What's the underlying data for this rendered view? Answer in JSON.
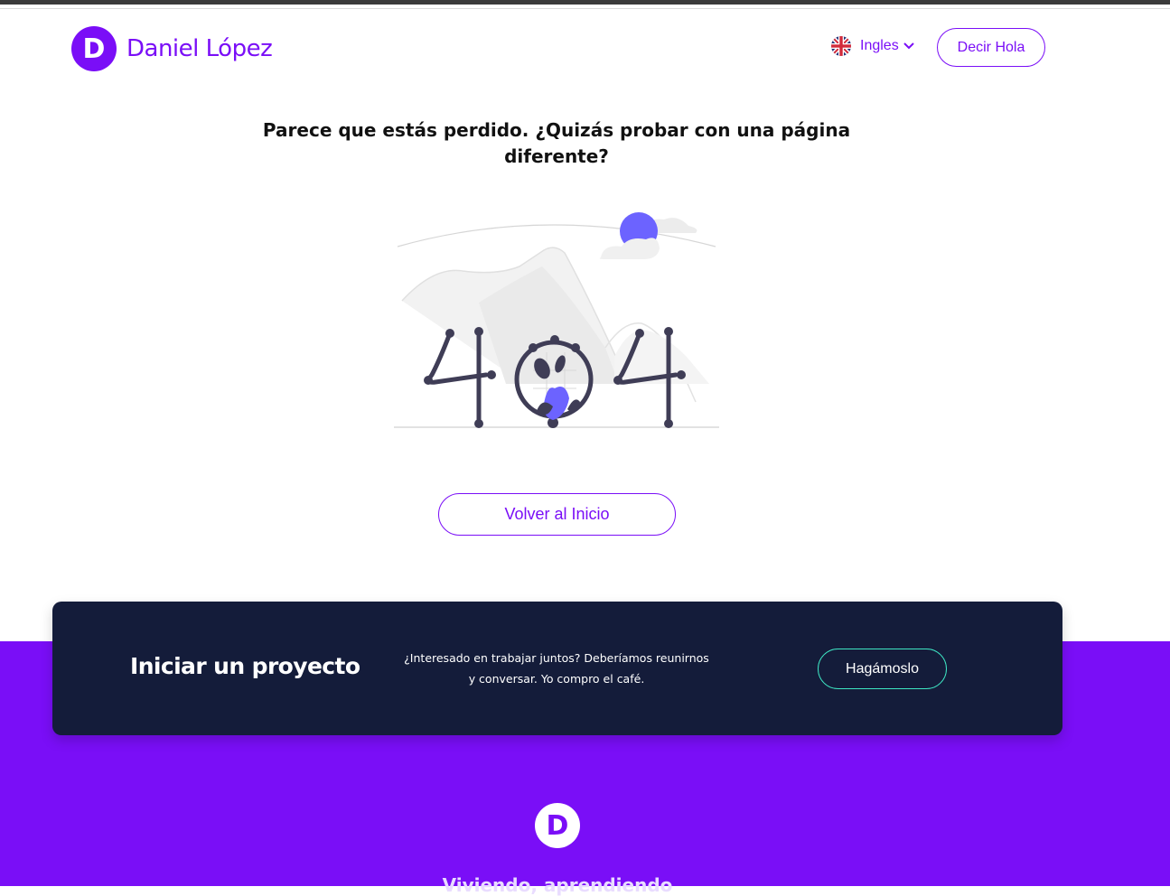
{
  "header": {
    "logo_letter": "D",
    "logo_name": "Daniel López",
    "language_label": "Ingles",
    "hello_button": "Decir Hola"
  },
  "main": {
    "lost_title": "Parece que estás perdido. ¿Quizás probar con una página diferente?",
    "home_button": "Volver al Inicio"
  },
  "cta": {
    "title": "Iniciar un proyecto",
    "text": "¿Interesado en trabajar juntos? Deberíamos reunirnos y conversar. Yo compro el café.",
    "button": "Hagámoslo"
  },
  "footer": {
    "logo_letter": "D",
    "tagline": "Viviendo, aprendiendo"
  },
  "colors": {
    "brand": "#7a0ef7",
    "card_bg": "#141c3a",
    "cta_button_border": "#3ee6c4"
  },
  "icons": {
    "flag": "uk-flag-icon",
    "chevron": "chevron-down-icon"
  }
}
